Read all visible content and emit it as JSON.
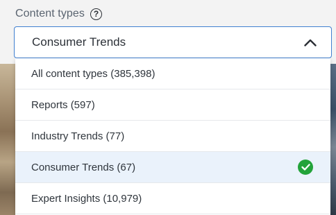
{
  "field": {
    "label": "Content types",
    "help_icon": "question-circle-icon",
    "selected_value": "Consumer Trends",
    "toggle_icon": "chevron-up-icon",
    "accent_color": "#3f7fd0"
  },
  "options": [
    {
      "label": "All content types (385,398)",
      "selected": false
    },
    {
      "label": "Reports (597)",
      "selected": false
    },
    {
      "label": "Industry Trends (77)",
      "selected": false
    },
    {
      "label": "Consumer Trends (67)",
      "selected": true,
      "icon": "check-circle-icon",
      "icon_color": "#23a33a"
    },
    {
      "label": "Expert Insights (10,979)",
      "selected": false
    }
  ]
}
